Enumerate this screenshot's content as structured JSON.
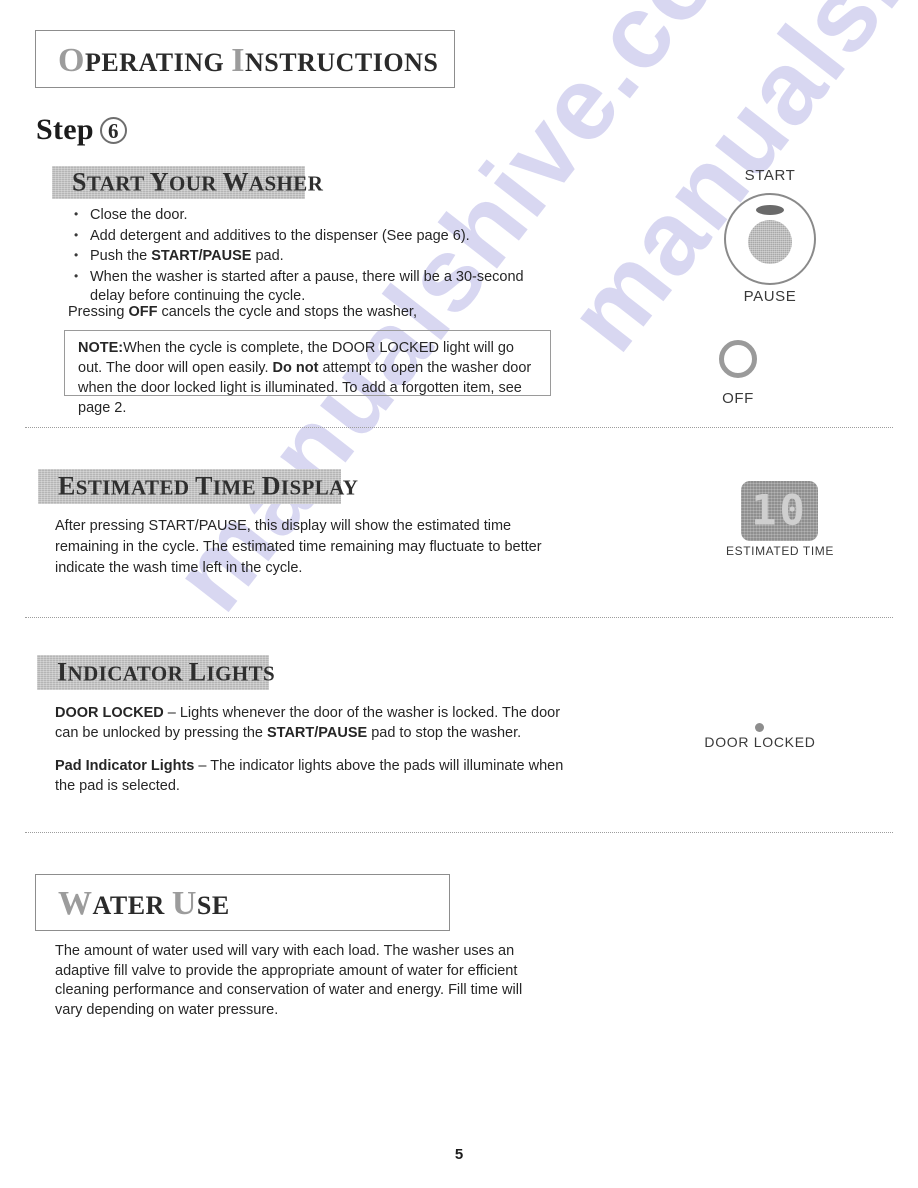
{
  "document": {
    "header_title_first_letter": "O",
    "header_title_rest": "PERATING ",
    "header_title_second_cap": "I",
    "header_title_second_rest": "NSTRUCTIONS",
    "header_title_full": "Operating Instructions",
    "step_label": "Step",
    "step_number": "6",
    "page_number": "5",
    "watermark_text": "manualshive.com"
  },
  "sections": {
    "start_your_washer": {
      "band_title_cap": "S",
      "band_title_rest": "TART ",
      "band_title_cap2": "Y",
      "band_title_rest2": "OUR ",
      "band_title_cap3": "W",
      "band_title_rest3": "ASHER",
      "band_title_full": "Start Your Washer",
      "bullets": [
        "Close the door.",
        "Add detergent and additives to the dispenser (See page 6).",
        "Push the START/PAUSE pad.",
        "When the washer is started after a pause, there will be a 30-second delay before continuing the cycle."
      ],
      "bullet3_prefix": "Push the ",
      "bullet3_bold": "START/PAUSE",
      "bullet3_suffix": " pad.",
      "closing_prefix": "Pressing ",
      "closing_bold": "OFF",
      "closing_suffix": " cancels the cycle and stops the washer,",
      "note": {
        "label": "NOTE:",
        "text_1": "When the cycle is complete, the DOOR LOCKED light will go out. The door will open easily. ",
        "bold_1": "Do not",
        "text_2": " attempt to open the washer door when the door locked light is illuminated. To add a forgotten item, see page 2."
      }
    },
    "estimated_time_display": {
      "band_title_cap": "E",
      "band_title_rest": "STIMATED ",
      "band_title_cap2": "T",
      "band_title_rest2": "IME ",
      "band_title_cap3": "D",
      "band_title_rest3": "ISPLAY",
      "band_title_full": "Estimated Time Display",
      "paragraph": "After pressing START/PAUSE, this display will show the estimated time remaining in the cycle. The estimated time remaining may fluctuate to better indicate the wash time left in the cycle."
    },
    "indicator_lights": {
      "band_title_cap": "I",
      "band_title_rest": "NDICATOR ",
      "band_title_cap2": "L",
      "band_title_rest2": "IGHTS",
      "band_title_full": "Indicator Lights",
      "door_locked": {
        "term": "DOOR LOCKED",
        "text_1": " – Lights whenever the door of the washer is locked. The door can be unlocked by pressing the ",
        "bold_1": "START/PAUSE",
        "text_2": " pad to stop the washer."
      },
      "pad_indicator_lights": {
        "term": "Pad Indicator Lights",
        "text_1": " – The indicator lights above the pads will illuminate when the pad is selected."
      }
    },
    "water_use": {
      "title_cap": "W",
      "title_rest": "ATER ",
      "title_cap2": "U",
      "title_rest2": "SE",
      "title_full": "Water Use",
      "paragraph": "The amount of water used will vary with each load. The washer uses an adaptive fill valve to provide the appropriate amount of water for efficient cleaning performance and conservation of water and energy. Fill time will vary depending on water pressure."
    }
  },
  "control_graphics": {
    "start_pause": {
      "top_label": "START",
      "bottom_label": "PAUSE"
    },
    "off_button": {
      "label": "OFF"
    },
    "estimated_time": {
      "display_value": "10",
      "caption": "ESTIMATED TIME"
    },
    "door_locked_indicator": {
      "caption": "DOOR LOCKED"
    }
  }
}
